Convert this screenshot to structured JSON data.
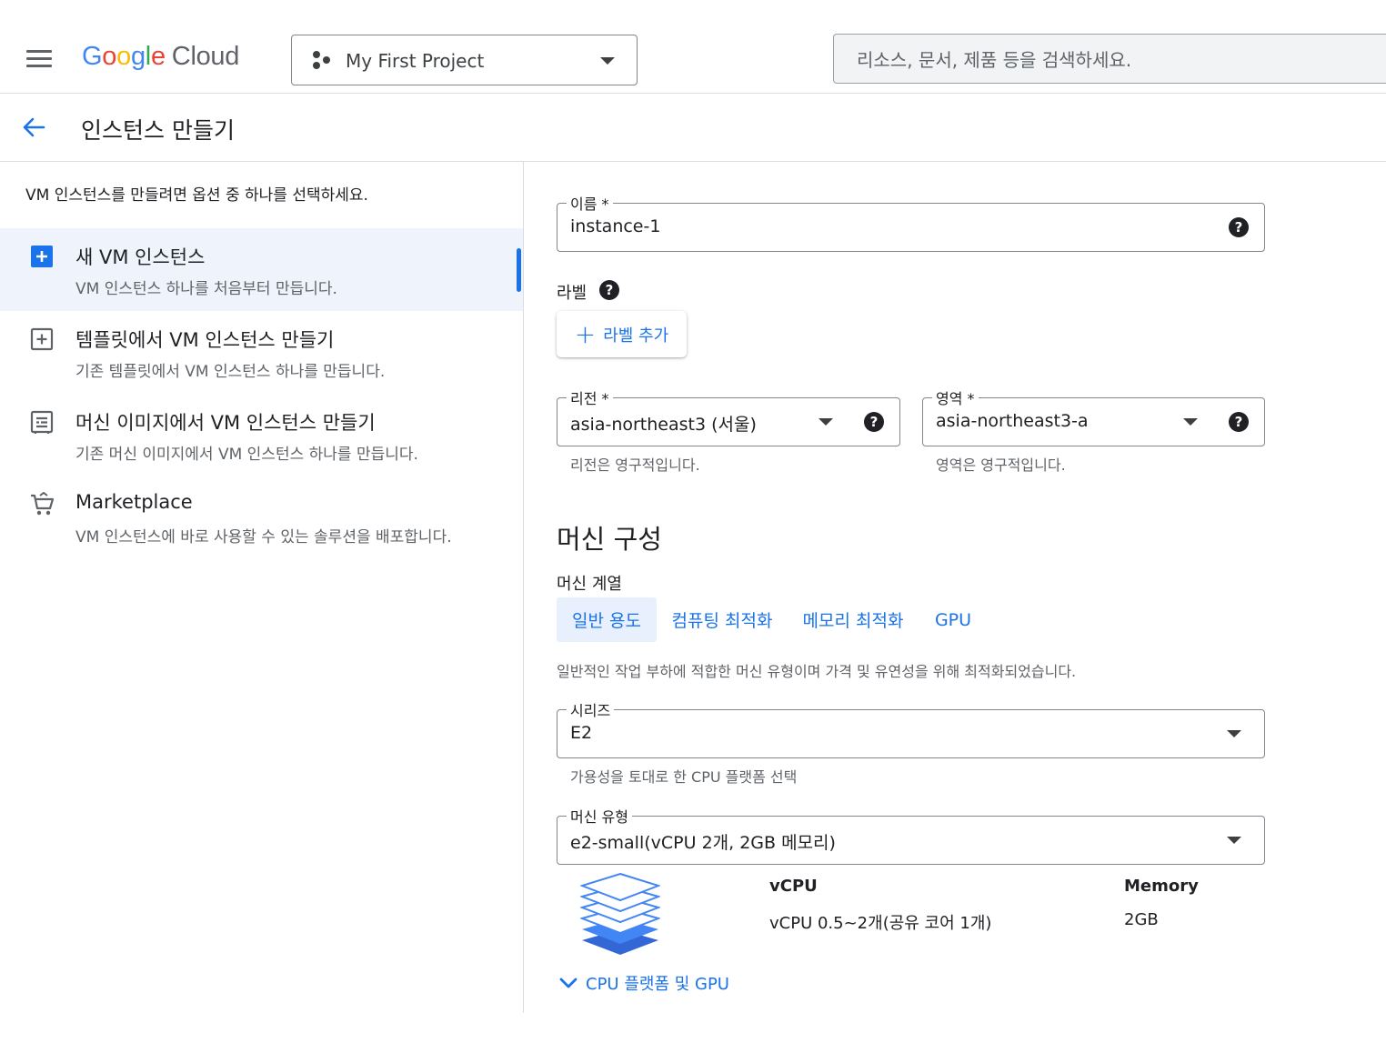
{
  "header": {
    "logo_google": [
      "G",
      "o",
      "o",
      "g",
      "l",
      "e"
    ],
    "logo_cloud": "Cloud",
    "project_name": "My First Project",
    "search_placeholder": "리소스, 문서, 제품 등을 검색하세요."
  },
  "page": {
    "title": "인스턴스 만들기"
  },
  "left_panel": {
    "intro": "VM 인스턴스를 만들려면 옵션 중 하나를 선택하세요.",
    "options": [
      {
        "title": "새 VM 인스턴스",
        "desc": "VM 인스턴스 하나를 처음부터 만듭니다.",
        "icon": "add-box-icon",
        "selected": true
      },
      {
        "title": "템플릿에서 VM 인스턴스 만들기",
        "desc": "기존 템플릿에서 VM 인스턴스 하나를 만듭니다.",
        "icon": "template-add-icon",
        "selected": false
      },
      {
        "title": "머신 이미지에서 VM 인스턴스 만들기",
        "desc": "기존 머신 이미지에서 VM 인스턴스 하나를 만듭니다.",
        "icon": "machine-image-icon",
        "selected": false
      },
      {
        "title": "Marketplace",
        "desc": "VM 인스턴스에 바로 사용할 수 있는 솔루션을 배포합니다.",
        "icon": "cart-icon",
        "selected": false
      }
    ]
  },
  "form": {
    "name": {
      "label": "이름 *",
      "value": "instance-1"
    },
    "labels": {
      "title": "라벨",
      "add_button": "라벨 추가"
    },
    "region": {
      "label": "리전 *",
      "value": "asia-northeast3 (서울)",
      "hint": "리전은 영구적입니다."
    },
    "zone": {
      "label": "영역 *",
      "value": "asia-northeast3-a",
      "hint": "영역은 영구적입니다."
    },
    "machine": {
      "title": "머신 구성",
      "family_label": "머신 계열",
      "tabs": [
        "일반 용도",
        "컴퓨팅 최적화",
        "메모리 최적화",
        "GPU"
      ],
      "active_tab": 0,
      "family_desc": "일반적인 작업 부하에 적합한 머신 유형이며 가격 및 유연성을 위해 최적화되었습니다.",
      "series": {
        "label": "시리즈",
        "value": "E2",
        "hint": "가용성을 토대로 한 CPU 플랫폼 선택"
      },
      "type": {
        "label": "머신 유형",
        "value": "e2-small(vCPU 2개, 2GB 메모리)"
      },
      "specs": {
        "vcpu_head": "vCPU",
        "vcpu_value": "vCPU 0.5~2개(공유 코어 1개)",
        "memory_head": "Memory",
        "memory_value": "2GB"
      },
      "expand_link": "CPU 플랫폼 및 GPU"
    }
  },
  "colors": {
    "accent": "#1a73e8",
    "selected_bg": "#eef3fc",
    "border": "#80868b",
    "divider": "#dadce0"
  }
}
